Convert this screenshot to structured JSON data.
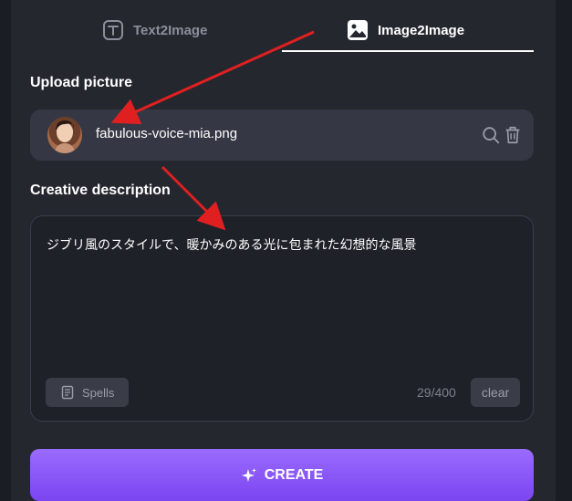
{
  "tabs": [
    {
      "label": "Text2Image",
      "icon": "text-icon",
      "active": false
    },
    {
      "label": "Image2Image",
      "icon": "image-icon",
      "active": true
    }
  ],
  "upload": {
    "label": "Upload picture",
    "filename": "fabulous-voice-mia.png",
    "actions": [
      "search-icon",
      "trash-icon"
    ]
  },
  "description": {
    "label": "Creative description",
    "text": "ジブリ風のスタイルで、暖かみのある光に包まれた幻想的な風景",
    "counter": "29/400",
    "spells_label": "Spells",
    "clear_label": "clear"
  },
  "create": {
    "label": "CREATE",
    "icon": "sparkle-icon"
  },
  "colors": {
    "background": "#1b1d24",
    "panel": "#25272f",
    "upload_row": "#353844",
    "accent_start": "#9a6bff",
    "accent_end": "#7b45f0",
    "annotation_arrow": "#e02020"
  }
}
